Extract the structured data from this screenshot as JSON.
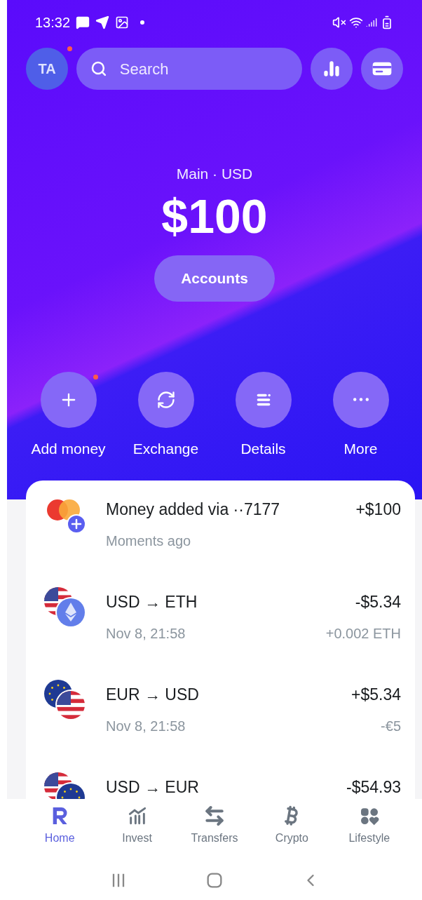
{
  "status_bar": {
    "time": "13:32"
  },
  "header": {
    "avatar": {
      "initials": "TA",
      "notification_dot": true
    },
    "search": {
      "placeholder": "Search"
    }
  },
  "balance": {
    "label": "Main · USD",
    "amount": "$100",
    "accounts_button": "Accounts"
  },
  "actions": [
    {
      "kind": "add",
      "label": "Add money",
      "notification_dot": true
    },
    {
      "kind": "exchange",
      "label": "Exchange",
      "notification_dot": false
    },
    {
      "kind": "details",
      "label": "Details",
      "notification_dot": false
    },
    {
      "kind": "more",
      "label": "More",
      "notification_dot": false
    }
  ],
  "transactions": [
    {
      "kind": "card-topup",
      "title": "Money added via ··7177",
      "subtitle": "Moments ago",
      "amount": "+$100"
    },
    {
      "kind": "usd-eth",
      "title": "USD → ETH",
      "subtitle": "Nov 8, 21:58",
      "amount": "-$5.34",
      "secondary_amount": "+0.002 ETH"
    },
    {
      "kind": "eur-usd",
      "title": "EUR → USD",
      "subtitle": "Nov 8, 21:58",
      "amount": "+$5.34",
      "secondary_amount": "-€5"
    },
    {
      "kind": "usd-eur",
      "title": "USD → EUR",
      "amount": "-$54.93"
    }
  ],
  "bottom_nav": [
    {
      "kind": "home",
      "label": "Home",
      "selected": true
    },
    {
      "kind": "invest",
      "label": "Invest",
      "selected": false
    },
    {
      "kind": "transfers",
      "label": "Transfers",
      "selected": false
    },
    {
      "kind": "crypto",
      "label": "Crypto",
      "selected": false
    },
    {
      "kind": "lifestyle",
      "label": "Lifestyle",
      "selected": false
    }
  ]
}
